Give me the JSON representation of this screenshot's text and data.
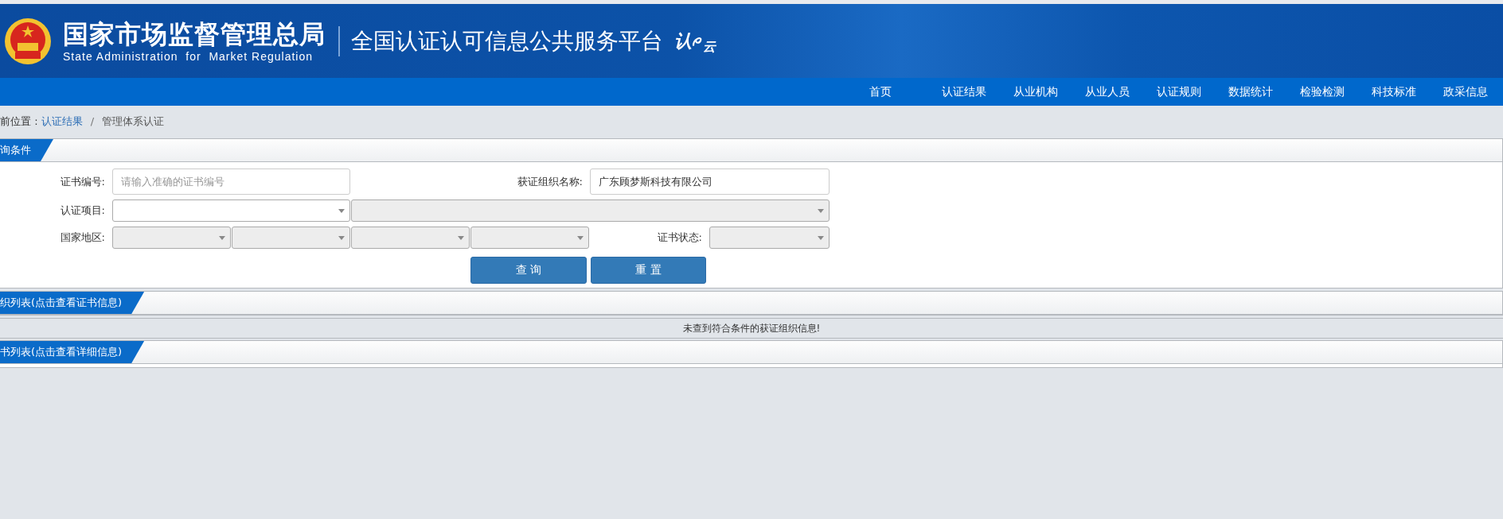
{
  "header": {
    "title": "国家市场监督管理总局",
    "subtitle": "State Administration  for  Market Regulation",
    "platform": "全国认证认可信息公共服务平台",
    "logo_left": "认",
    "logo_right": "云"
  },
  "nav": [
    {
      "label": "首页",
      "selected": false
    },
    {
      "label": "认证结果",
      "selected": false
    },
    {
      "label": "从业机构",
      "selected": false
    },
    {
      "label": "从业人员",
      "selected": false
    },
    {
      "label": "认证规则",
      "selected": false
    },
    {
      "label": "数据统计",
      "selected": false
    },
    {
      "label": "检验检测",
      "selected": false
    },
    {
      "label": "科技标准",
      "selected": false
    },
    {
      "label": "政采信息",
      "selected": false
    }
  ],
  "breadcrumb": {
    "prefix": "前位置 : ",
    "link": "认证结果",
    "separator": "/",
    "current": "管理体系认证"
  },
  "query_panel": {
    "title": "询条件",
    "cert_no": {
      "label": "证书编号:",
      "placeholder": "请输入准确的证书编号"
    },
    "org_name": {
      "label": "获证组织名称:",
      "value": "广东顾梦斯科技有限公司"
    },
    "project": {
      "label": "认证项目:",
      "selects": [
        {
          "disabled": false
        },
        {
          "disabled": true
        }
      ]
    },
    "region": {
      "label": "国家地区:",
      "selects": [
        {
          "disabled": true
        },
        {
          "disabled": true
        },
        {
          "disabled": true
        },
        {
          "disabled": true
        }
      ]
    },
    "status": {
      "label": "证书状态:",
      "disabled": true
    },
    "buttons": [
      "查 询",
      "重 置"
    ]
  },
  "org_list": {
    "title": "织列表(点击查看证书信息)",
    "message": "未查到符合条件的获证组织信息!"
  },
  "cert_list": {
    "title": "书列表(点击查看详细信息)"
  }
}
